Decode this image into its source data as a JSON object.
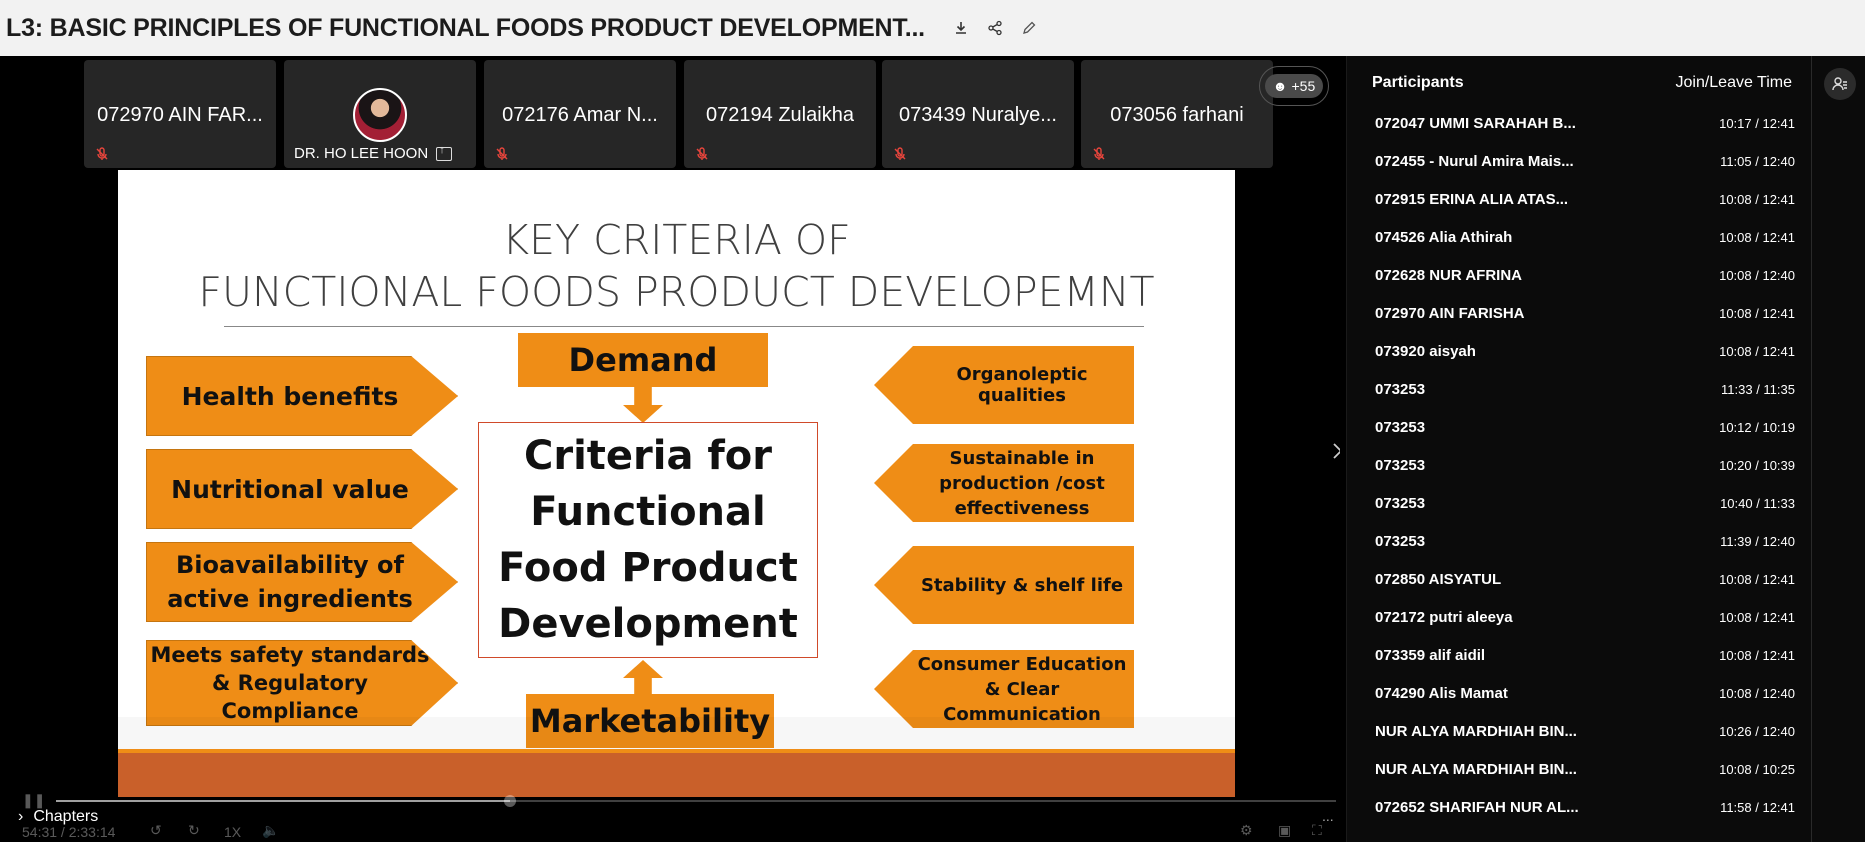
{
  "header": {
    "title": "L3: BASIC PRINCIPLES OF FUNCTIONAL FOODS PRODUCT DEVELOPMENT..."
  },
  "video_tiles": [
    {
      "name": "072970 AIN FAR..."
    },
    {
      "name": "DR. HO LEE HOON"
    },
    {
      "name": "072176 Amar N..."
    },
    {
      "name": "072194 Zulaikha"
    },
    {
      "name": "073439 Nuralye..."
    },
    {
      "name": "073056 farhani"
    }
  ],
  "more_participants": "+55",
  "slide": {
    "title_line1": "KEY CRITERIA OF",
    "title_line2": "FUNCTIONAL FOODS PRODUCT DEVELOPEMNT",
    "left": [
      "Health benefits",
      "Nutritional value",
      "Bioavailability of active ingredients",
      "Meets safety standards & Regulatory Compliance"
    ],
    "right": [
      "Organoleptic qualities",
      "Sustainable in production /cost effectiveness",
      "Stability & shelf life",
      "Consumer Education & Clear Communication"
    ],
    "top": "Demand",
    "bottom": "Marketability",
    "center": "Criteria for Functional Food Product Development"
  },
  "player": {
    "time": "54:31 / 2:33:14",
    "speed": "1X",
    "progress_fraction": 0.355,
    "chapters_label": "Chapters",
    "ellipsis": "..."
  },
  "participants_panel": {
    "title": "Participants",
    "col_time": "Join/Leave Time",
    "rows": [
      {
        "name": "072047 UMMI SARAHAH B...",
        "time": "10:17 / 12:41"
      },
      {
        "name": "072455 - Nurul Amira Mais...",
        "time": "11:05 / 12:40"
      },
      {
        "name": "072915 ERINA ALIA ATAS...",
        "time": "10:08 / 12:41"
      },
      {
        "name": "074526 Alia Athirah",
        "time": "10:08 / 12:41"
      },
      {
        "name": "072628 NUR AFRINA",
        "time": "10:08 / 12:40"
      },
      {
        "name": "072970 AIN FARISHA",
        "time": "10:08 / 12:41"
      },
      {
        "name": "073920 aisyah",
        "time": "10:08 / 12:41"
      },
      {
        "name": "073253",
        "time": "11:33 / 11:35"
      },
      {
        "name": "073253",
        "time": "10:12 / 10:19"
      },
      {
        "name": "073253",
        "time": "10:20 / 10:39"
      },
      {
        "name": "073253",
        "time": "10:40 / 11:33"
      },
      {
        "name": "073253",
        "time": "11:39 / 12:40"
      },
      {
        "name": "072850 AISYATUL",
        "time": "10:08 / 12:41"
      },
      {
        "name": "072172 putri aleeya",
        "time": "10:08 / 12:41"
      },
      {
        "name": "073359 alif aidil",
        "time": "10:08 / 12:41"
      },
      {
        "name": "074290 Alis Mamat",
        "time": "10:08 / 12:40"
      },
      {
        "name": "NUR ALYA MARDHIAH BIN...",
        "time": "10:26 / 12:40"
      },
      {
        "name": "NUR ALYA MARDHIAH BIN...",
        "time": "10:08 / 10:25"
      },
      {
        "name": "072652 SHARIFAH NUR AL...",
        "time": "11:58 / 12:41"
      }
    ]
  },
  "colors": {
    "slide_orange": "#ef8d16",
    "slide_footer": "#c9602a",
    "panel_bg": "#0b0b0b"
  }
}
